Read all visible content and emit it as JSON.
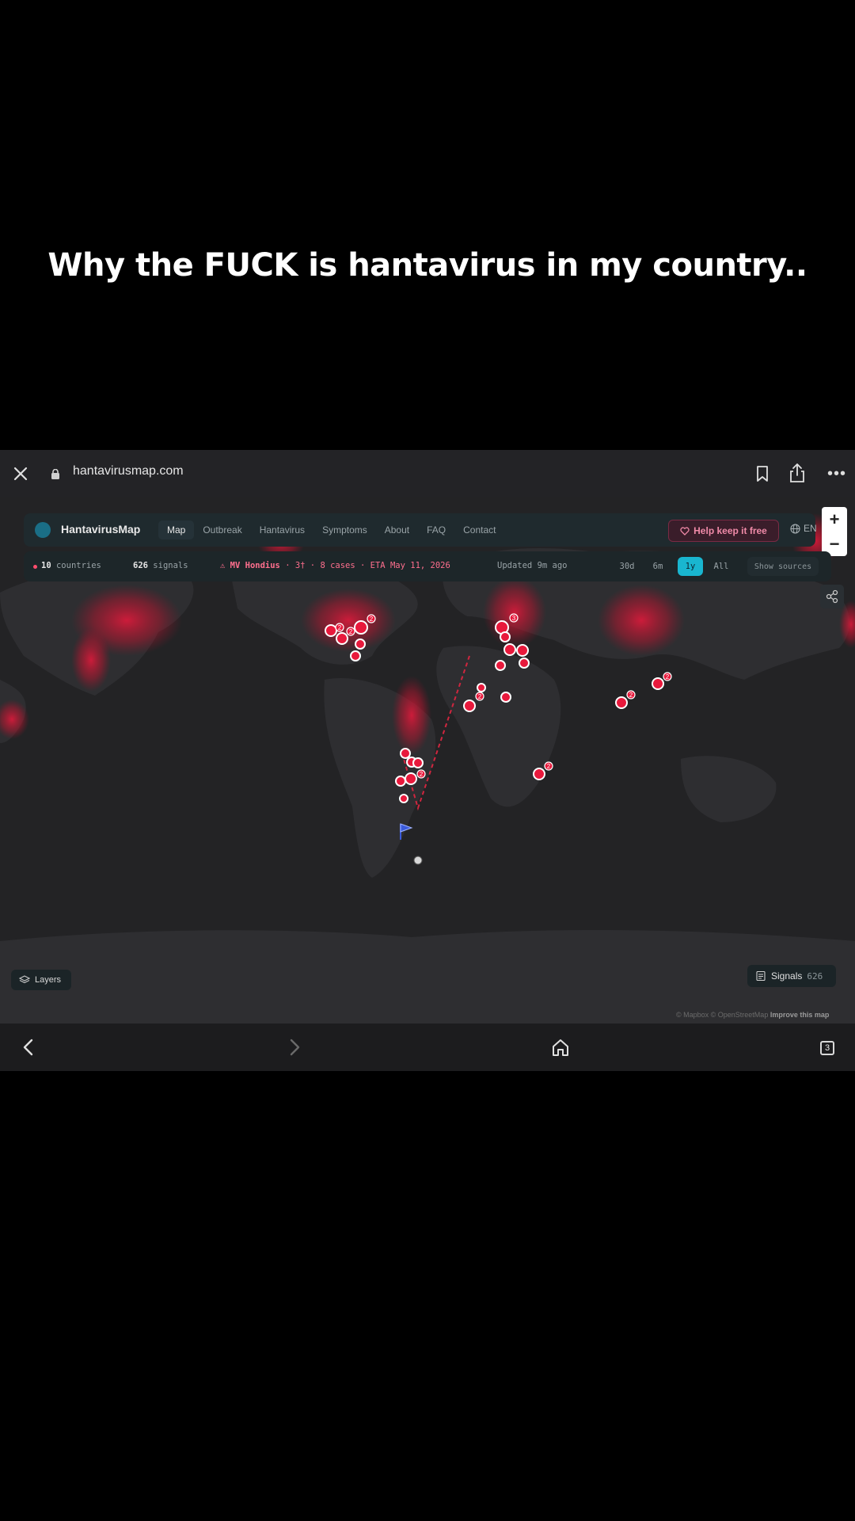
{
  "caption": "Why the FUCK is hantavirus in my country..",
  "browser": {
    "url": "hantavirusmap.com",
    "tab_count": "3"
  },
  "nav": {
    "brand": "HantavirusMap",
    "links": [
      "Map",
      "Outbreak",
      "Hantavirus",
      "Symptoms",
      "About",
      "FAQ",
      "Contact"
    ],
    "active": "Map",
    "help_label": "Help keep it free",
    "language": "EN"
  },
  "stats": {
    "countries_count": "10",
    "countries_label": "countries",
    "signals_count": "626",
    "signals_label": "signals",
    "ship_name": "MV Hondius",
    "ship_detail": "· 3† · 8 cases · ETA May 11, 2026",
    "updated": "Updated 9m ago",
    "ranges": [
      "30d",
      "6m",
      "1y",
      "All"
    ],
    "active_range": "1y",
    "show_sources": "Show sources"
  },
  "map": {
    "layers_label": "Layers",
    "signals_label": "Signals",
    "signals_count": "626",
    "attribution": "© Mapbox © OpenStreetMap",
    "improve_link": "Improve this map",
    "cluster_counts": [
      "2",
      "2",
      "2",
      "2",
      "3",
      "2",
      "2",
      "2",
      "2",
      "2"
    ],
    "colors": {
      "marker": "#e8193c",
      "ship_route": "#d0263f",
      "flag": "#3b5bdb",
      "accent": "#19b6d0"
    }
  }
}
